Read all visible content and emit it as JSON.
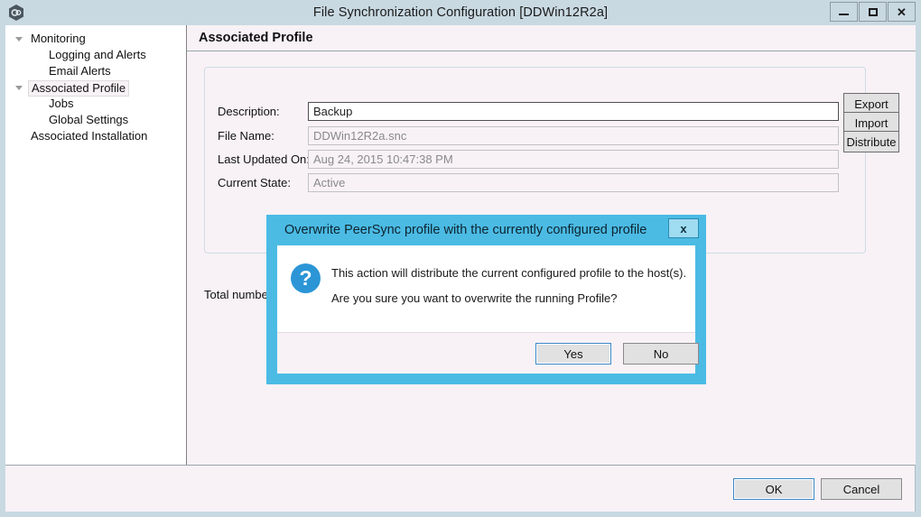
{
  "window": {
    "title": "File Synchronization Configuration [DDWin12R2a]",
    "app_icon": "gear-hex-icon",
    "controls": {
      "minimize": "minimize-icon",
      "maximize": "maximize-icon",
      "close": "✕"
    }
  },
  "sidebar": {
    "items": [
      {
        "label": "Monitoring",
        "level": 0,
        "expander": "expanded",
        "selected": false
      },
      {
        "label": "Logging and Alerts",
        "level": 1,
        "expander": "none",
        "selected": false
      },
      {
        "label": "Email Alerts",
        "level": 1,
        "expander": "none",
        "selected": false
      },
      {
        "label": "Associated Profile",
        "level": 0,
        "expander": "expanded",
        "selected": true
      },
      {
        "label": "Jobs",
        "level": 1,
        "expander": "none",
        "selected": false
      },
      {
        "label": "Global Settings",
        "level": 1,
        "expander": "none",
        "selected": false
      },
      {
        "label": "Associated Installation",
        "level": 0,
        "expander": "none",
        "selected": false
      }
    ]
  },
  "content": {
    "header": "Associated Profile",
    "fields": [
      {
        "label": "Description:",
        "value": "Backup",
        "placeholder": "",
        "readonly": false
      },
      {
        "label": "File Name:",
        "value": "DDWin12R2a.snc",
        "placeholder": "",
        "readonly": true
      },
      {
        "label": "Last Updated On:",
        "value": "Aug 24, 2015 10:47:38 PM",
        "placeholder": "",
        "readonly": true
      },
      {
        "label": "Current State:",
        "value": "Active",
        "placeholder": "",
        "readonly": true
      }
    ],
    "side_buttons": [
      {
        "label": "Export"
      },
      {
        "label": "Import"
      },
      {
        "label": "Distribute"
      }
    ],
    "total_text": "Total numbe"
  },
  "footer": {
    "ok_label": "OK",
    "cancel_label": "Cancel"
  },
  "dialog": {
    "title": "Overwrite PeerSync profile with the currently configured profile",
    "close_label": "x",
    "icon": "?",
    "message_line1": "This action will distribute the current configured profile to the host(s).",
    "message_line2": "Are you sure you want to overwrite the running Profile?",
    "yes_label": "Yes",
    "no_label": "No"
  },
  "colors": {
    "titlebar": "#c9d9e2",
    "content_bg": "#f8f2f6",
    "dialog_accent": "#4bbbe4",
    "focus_blue": "#3c87c8",
    "icon_blue": "#2b95d6"
  }
}
